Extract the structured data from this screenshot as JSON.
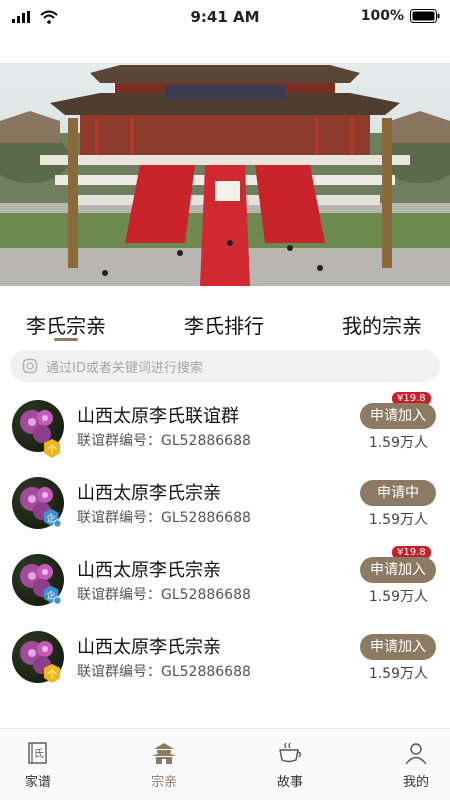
{
  "status_bar": {
    "time": "9:41 AM",
    "battery": "100%"
  },
  "tabs": [
    {
      "label": "李氏宗亲"
    },
    {
      "label": "李氏排行"
    },
    {
      "label": "我的宗亲"
    }
  ],
  "search": {
    "placeholder": "通过ID或者关键词进行搜索"
  },
  "list": [
    {
      "title": "山西太原李氏联谊群",
      "subtitle": "联谊群编号：GL52886688",
      "action": "申请加入",
      "price": "¥19.8",
      "members": "1.59万人",
      "badge": "个"
    },
    {
      "title": "山西太原李氏宗亲",
      "subtitle": "联谊群编号：GL52886688",
      "action": "申请中",
      "price": "",
      "members": "1.59万人",
      "badge": "企"
    },
    {
      "title": "山西太原李氏宗亲",
      "subtitle": "联谊群编号：GL52886688",
      "action": "申请加入",
      "price": "¥19.8",
      "members": "1.59万人",
      "badge": "企"
    },
    {
      "title": "山西太原李氏宗亲",
      "subtitle": "联谊群编号：GL52886688",
      "action": "申请加入",
      "price": "",
      "members": "1.59万人",
      "badge": "个"
    }
  ],
  "nav": [
    {
      "label": "家谱",
      "icon": "氏"
    },
    {
      "label": "宗亲"
    },
    {
      "label": "故事"
    },
    {
      "label": "我的"
    }
  ],
  "colors": {
    "accent": "#8a7d63",
    "price_badge": "#c62026",
    "action_button": "#8c7a63"
  }
}
